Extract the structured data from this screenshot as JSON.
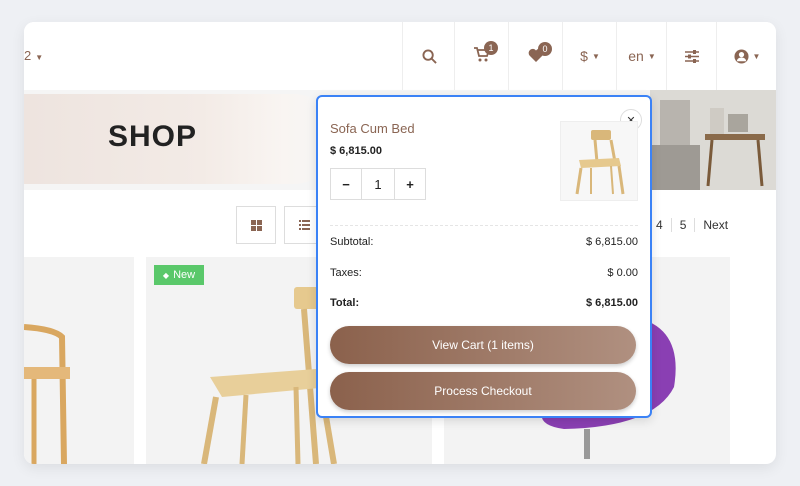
{
  "header": {
    "left_fragment": "2",
    "cart_count": "1",
    "wishlist_count": "0",
    "currency": "$",
    "language": "en"
  },
  "banner": {
    "title": "SHOP"
  },
  "pagination": {
    "pages": [
      "4",
      "5"
    ],
    "next": "Next"
  },
  "product_badge": "New",
  "cart_popup": {
    "product_name": "Sofa Cum Bed",
    "product_price": "$ 6,815.00",
    "quantity": "1",
    "subtotal_label": "Subtotal:",
    "subtotal_value": "$ 6,815.00",
    "taxes_label": "Taxes:",
    "taxes_value": "$ 0.00",
    "total_label": "Total:",
    "total_value": "$ 6,815.00",
    "view_cart": "View Cart (1 items)",
    "checkout": "Process Checkout"
  },
  "colors": {
    "accent": "#8a6553",
    "new_badge": "#5ac86a",
    "popup_border": "#3b82f6"
  }
}
